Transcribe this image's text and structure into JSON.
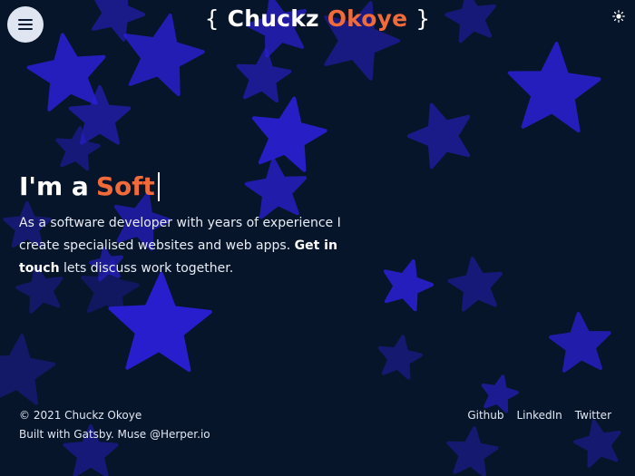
{
  "header": {
    "brace_open": "{",
    "first_name": "Chuckz",
    "last_name": "Okoye",
    "brace_close": "}",
    "menu_icon": "hamburger-icon",
    "theme_icon": "sun-icon"
  },
  "hero": {
    "prefix": "I'm a",
    "typed": "Soft",
    "text_before": "As a software developer with years of experience I create specialised websites and web apps.",
    "cta": "Get in touch",
    "text_after": "lets discuss work together."
  },
  "footer": {
    "copyright": "© 2021 Chuckz Okoye",
    "built_with": "Built with Gatsby. Muse @Herper.io",
    "links": [
      "Github",
      "LinkedIn",
      "Twitter"
    ]
  },
  "colors": {
    "background": "#07152b",
    "accent": "#f06a3a",
    "star": "#2b1fd6"
  }
}
